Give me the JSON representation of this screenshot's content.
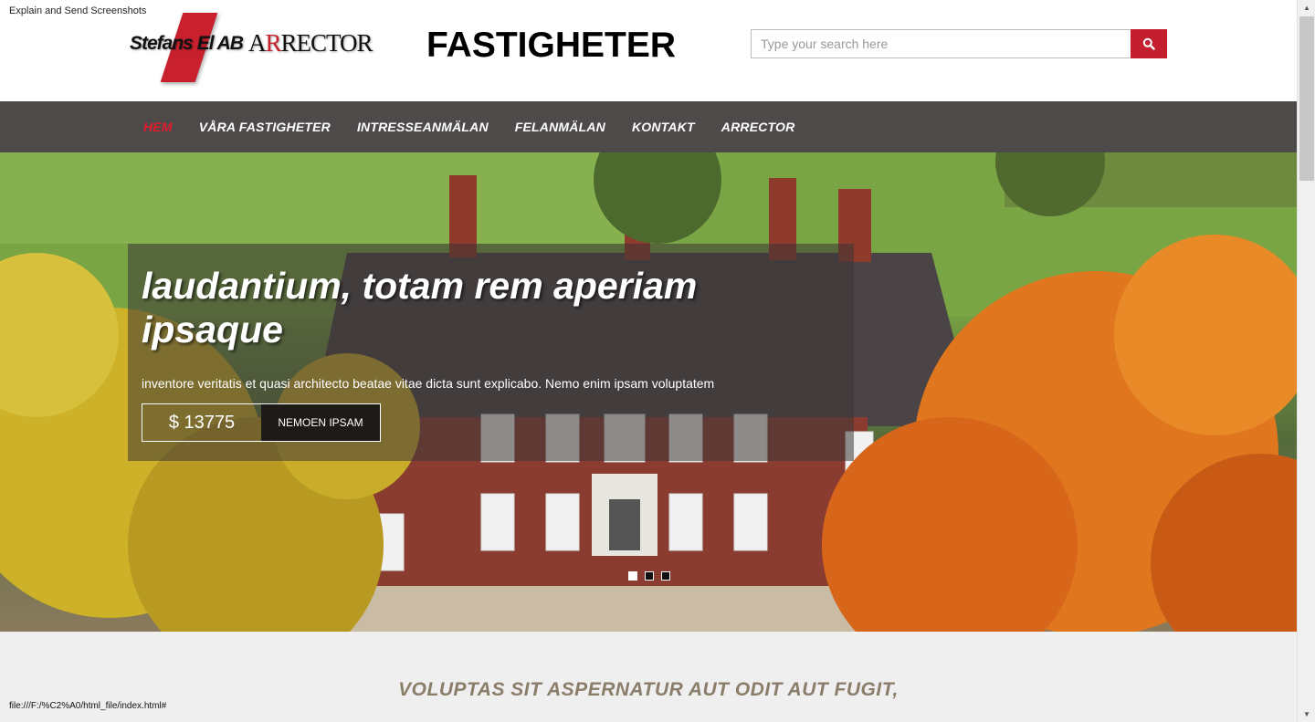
{
  "extension_label": "Explain and Send Screenshots",
  "logo": {
    "part1": "Stefans El AB",
    "part2_prefix": "A",
    "part2_accent": "R",
    "part2_rest": "RECTOR"
  },
  "site_title": "FASTIGHETER",
  "search": {
    "placeholder": "Type your search here",
    "icon": "search-icon"
  },
  "nav": {
    "items": [
      {
        "label": "HEM",
        "active": true
      },
      {
        "label": "VÅRA FASTIGHETER",
        "active": false
      },
      {
        "label": "INTRESSEANMÄLAN",
        "active": false
      },
      {
        "label": "FELANMÄLAN",
        "active": false
      },
      {
        "label": "KONTAKT",
        "active": false
      },
      {
        "label": "ARRECTOR",
        "active": false
      }
    ]
  },
  "hero": {
    "title": "laudantium, totam rem aperiam ipsaque",
    "subtitle": "inventore veritatis et quasi architecto beatae vitae dicta sunt explicabo. Nemo enim ipsam voluptatem",
    "price": "$ 13775",
    "button_label": "NEMOEN IPSAM",
    "slides": 3,
    "active_slide": 0
  },
  "section": {
    "heading": "VOLUPTAS SIT ASPERNATUR AUT ODIT AUT FUGIT,"
  },
  "status_bar": "file:///F:/%C2%A0/html_file/index.html#",
  "colors": {
    "accent_red": "#c41f2e",
    "nav_bg": "#4f4a4a",
    "nav_active": "#e31c2b",
    "heading_brown": "#8a7d6a"
  }
}
